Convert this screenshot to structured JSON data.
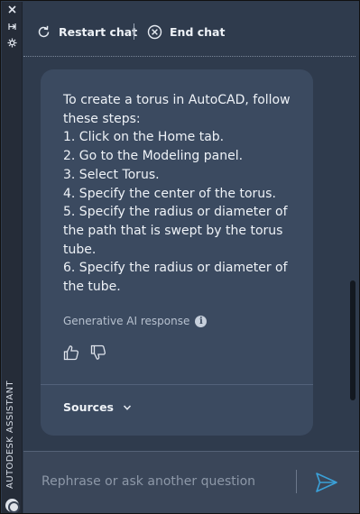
{
  "window": {
    "strip_title": "AUTODESK ASSISTANT",
    "strip_buttons": [
      "close-icon",
      "auto-hide-icon",
      "properties-icon"
    ]
  },
  "toolbar": {
    "restart_label": "Restart chat",
    "end_label": "End chat"
  },
  "message": {
    "lines": [
      "To create a torus in AutoCAD, follow these steps:",
      "1. Click on the Home tab.",
      "2. Go to the Modeling panel.",
      "3. Select Torus.",
      "4. Specify the center of the torus.",
      "5. Specify the radius or diameter of the path that is swept by the torus tube.",
      "6. Specify the radius or diameter of the tube."
    ],
    "generative_label": "Generative AI response",
    "sources_label": "Sources"
  },
  "input": {
    "placeholder": "Rephrase or ask another question"
  },
  "colors": {
    "panel_bg": "#2f3b4d",
    "bubble_bg": "#3b4a60",
    "send_accent": "#3aa0d8"
  }
}
